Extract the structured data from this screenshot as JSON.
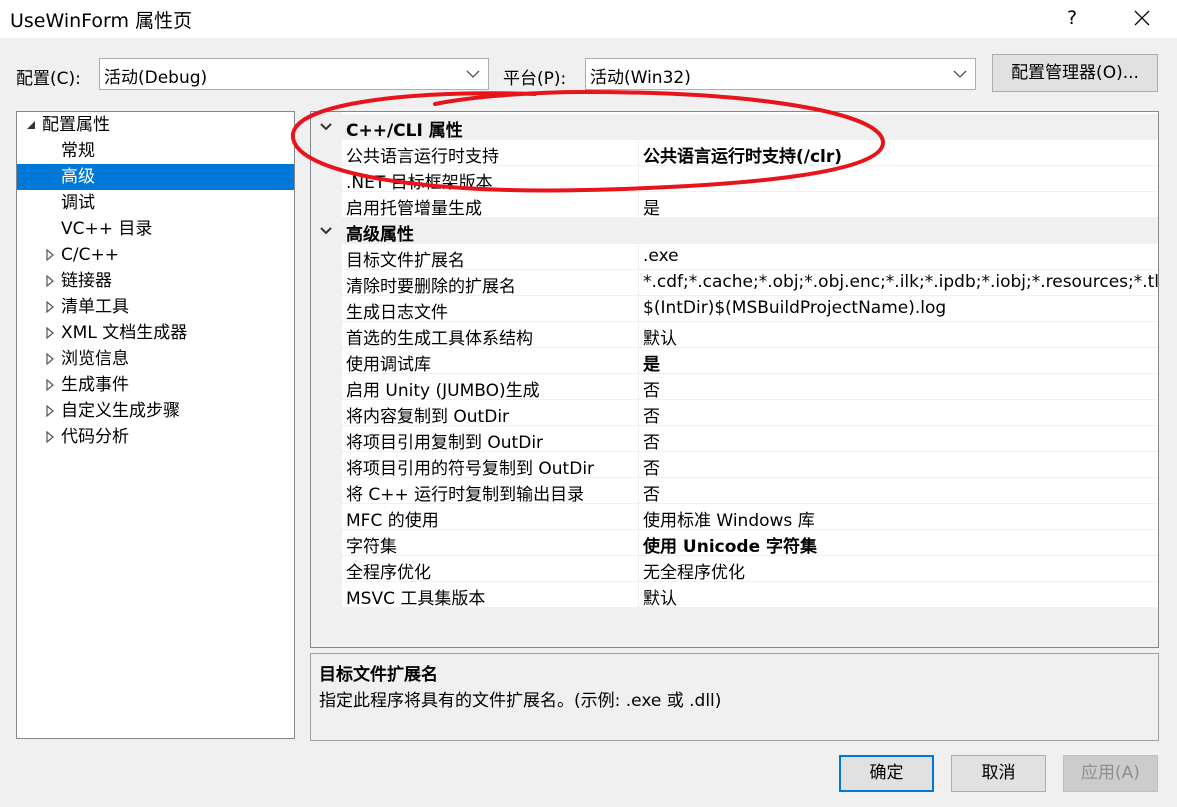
{
  "window": {
    "title": "UseWinForm 属性页",
    "help_label": "?",
    "colors": {
      "accent": "#0078d7",
      "annotation": "#e8141c"
    }
  },
  "toolbar": {
    "config_label": "配置(C):",
    "config_value": "活动(Debug)",
    "platform_label": "平台(P):",
    "platform_value": "活动(Win32)",
    "config_manager_label": "配置管理器(O)..."
  },
  "tree": {
    "items": [
      {
        "label": "配置属性",
        "expanded": true,
        "indent": 0
      },
      {
        "label": "常规",
        "indent": 1
      },
      {
        "label": "高级",
        "indent": 1,
        "selected": true
      },
      {
        "label": "调试",
        "indent": 1
      },
      {
        "label": "VC++ 目录",
        "indent": 1
      },
      {
        "label": "C/C++",
        "indent": 1,
        "collapsed": true
      },
      {
        "label": "链接器",
        "indent": 1,
        "collapsed": true
      },
      {
        "label": "清单工具",
        "indent": 1,
        "collapsed": true
      },
      {
        "label": "XML 文档生成器",
        "indent": 1,
        "collapsed": true
      },
      {
        "label": "浏览信息",
        "indent": 1,
        "collapsed": true
      },
      {
        "label": "生成事件",
        "indent": 1,
        "collapsed": true
      },
      {
        "label": "自定义生成步骤",
        "indent": 1,
        "collapsed": true
      },
      {
        "label": "代码分析",
        "indent": 1,
        "collapsed": true
      }
    ]
  },
  "grid": {
    "categories": [
      {
        "title": "C++/CLI 属性",
        "rows": [
          {
            "name": "公共语言运行时支持",
            "value": "公共语言运行时支持(/clr)",
            "bold": true
          },
          {
            "name": ".NET 目标框架版本",
            "value": ""
          },
          {
            "name": "启用托管增量生成",
            "value": "是"
          }
        ]
      },
      {
        "title": "高级属性",
        "rows": [
          {
            "name": "目标文件扩展名",
            "value": ".exe"
          },
          {
            "name": "清除时要删除的扩展名",
            "value": "*.cdf;*.cache;*.obj;*.obj.enc;*.ilk;*.ipdb;*.iobj;*.resources;*.tlb;*"
          },
          {
            "name": "生成日志文件",
            "value": "$(IntDir)$(MSBuildProjectName).log"
          },
          {
            "name": "首选的生成工具体系结构",
            "value": "默认"
          },
          {
            "name": "使用调试库",
            "value": "是",
            "bold": true
          },
          {
            "name": "启用 Unity (JUMBO)生成",
            "value": "否"
          },
          {
            "name": "将内容复制到 OutDir",
            "value": "否"
          },
          {
            "name": "将项目引用复制到 OutDir",
            "value": "否"
          },
          {
            "name": "将项目引用的符号复制到 OutDir",
            "value": "否"
          },
          {
            "name": "将 C++ 运行时复制到输出目录",
            "value": "否"
          },
          {
            "name": "MFC 的使用",
            "value": "使用标准 Windows 库"
          },
          {
            "name": "字符集",
            "value": "使用 Unicode 字符集",
            "bold": true
          },
          {
            "name": "全程序优化",
            "value": "无全程序优化"
          },
          {
            "name": "MSVC 工具集版本",
            "value": "默认"
          }
        ]
      }
    ]
  },
  "description": {
    "title": "目标文件扩展名",
    "text": "指定此程序将具有的文件扩展名。(示例: .exe 或 .dll)"
  },
  "buttons": {
    "ok": "确定",
    "cancel": "取消",
    "apply": "应用(A)"
  }
}
